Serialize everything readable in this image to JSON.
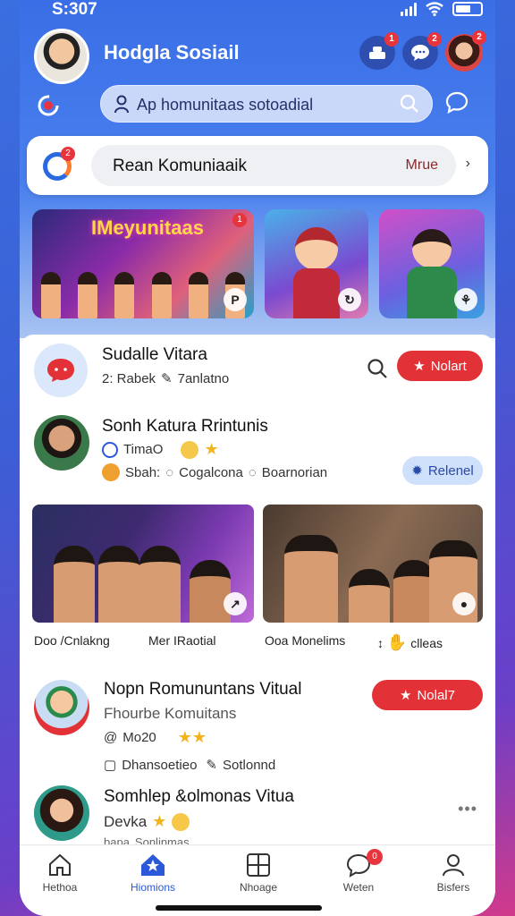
{
  "status_bar": {
    "time": "S:307"
  },
  "header": {
    "title": "Hodgla Sosiail",
    "notif_badges": [
      "1",
      "2",
      "2"
    ]
  },
  "search": {
    "placeholder": "Ap homunitaas sotoadial"
  },
  "reel": {
    "label": "Rean Komuniaaik",
    "more": "Mrue",
    "badge": "2"
  },
  "stories": [
    {
      "title": "IMeyunitaas",
      "badge": "1",
      "corner": "P"
    },
    {
      "title": "",
      "corner": ""
    },
    {
      "title": "",
      "corner": ""
    }
  ],
  "posts": [
    {
      "name": "Sudalle Vitara",
      "meta": "2: Rabek",
      "meta2": "7anlatno",
      "button": "Nolart"
    },
    {
      "name": "Sonh Katura Rrintunis",
      "tag": "TimaO",
      "meta_a": "Sbah:",
      "meta_b": "Cogalcona",
      "meta_c": "Boarnorian",
      "button": "Relenel",
      "captions": [
        "Doo /Cnlakng",
        "Mer IRaotial",
        "Ooa Monelims",
        "clleas"
      ]
    },
    {
      "name": "Nopn Romununtans Vitual",
      "subtitle": "Fhourbe Komuitans",
      "tag": "Mo20",
      "meta_a": "Dhansoetieo",
      "meta_b": "Sotlonnd",
      "button": "Nolal7"
    },
    {
      "name": "Somhlep &olmonas Vitua",
      "subtitle": "Devka",
      "meta_a": "bapa",
      "meta_b": "Sonlinmas"
    }
  ],
  "bottom_nav": [
    {
      "label": "Hethoa"
    },
    {
      "label": "Hiomions"
    },
    {
      "label": "Nhoage"
    },
    {
      "label": "Weten",
      "badge": "0"
    },
    {
      "label": "Bisfers"
    }
  ],
  "colors": {
    "accent": "#2a58d8",
    "brand_red": "#e23238",
    "header_blue": "#3a6ee6"
  }
}
